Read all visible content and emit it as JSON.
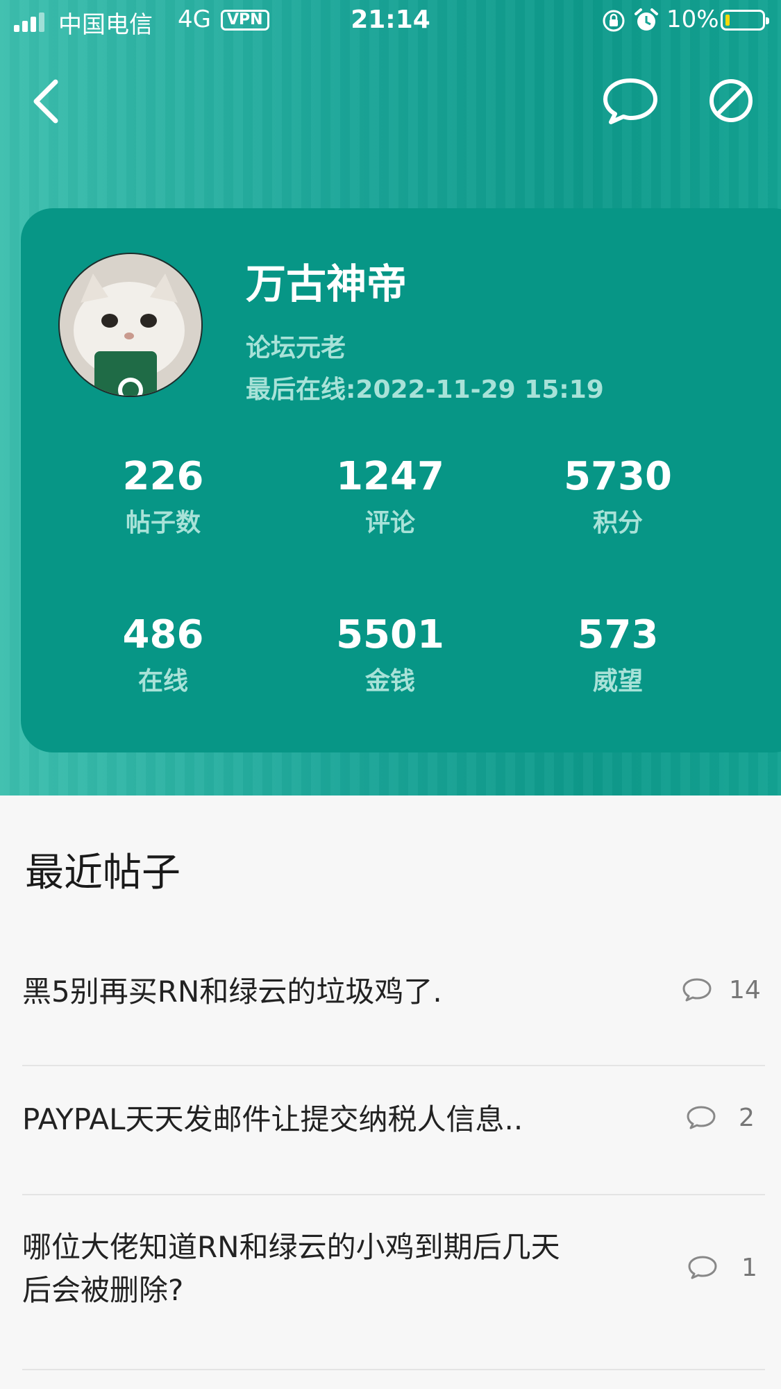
{
  "status_bar": {
    "carrier": "中国电信",
    "network": "4G",
    "vpn": "VPN",
    "time": "21:14",
    "battery": "10%"
  },
  "nav": {
    "back_icon": "chevron-left-icon",
    "message_icon": "chat-bubble-icon",
    "block_icon": "block-icon"
  },
  "profile": {
    "username": "万古神帝",
    "title": "论坛元老",
    "last_online": "最后在线:2022-11-29 15:19",
    "stats": [
      {
        "value": "226",
        "label": "帖子数"
      },
      {
        "value": "1247",
        "label": "评论"
      },
      {
        "value": "5730",
        "label": "积分"
      },
      {
        "value": "486",
        "label": "在线"
      },
      {
        "value": "5501",
        "label": "金钱"
      },
      {
        "value": "573",
        "label": "威望"
      }
    ]
  },
  "recent": {
    "heading": "最近帖子",
    "posts": [
      {
        "title": "黑5别再买RN和绿云的垃圾鸡了.",
        "comments": "14"
      },
      {
        "title": "PAYPAL天天发邮件让提交纳税人信息..",
        "comments": "2"
      },
      {
        "title_line1": "哪位大佬知道RN和绿云的小鸡到期后几天",
        "title_line2": "后会被删除?",
        "comments": "1"
      }
    ]
  },
  "colors": {
    "card": "#079686",
    "header_gradient_left": "#3dbfae",
    "header_gradient_right": "#0e9a8b",
    "label_text": "#a8e2d8",
    "page_bg": "#f7f7f7"
  }
}
